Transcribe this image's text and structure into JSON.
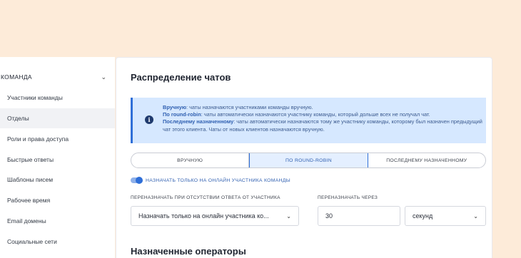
{
  "sidebar": {
    "section_label": "КОМАНДА",
    "items": [
      {
        "label": "Участники команды"
      },
      {
        "label": "Отделы"
      },
      {
        "label": "Роли и права доступа"
      },
      {
        "label": "Быстрые ответы"
      },
      {
        "label": "Шаблоны писем"
      },
      {
        "label": "Рабочее время"
      },
      {
        "label": "Email домены"
      },
      {
        "label": "Социальные сети"
      }
    ],
    "active_item": "Отделы"
  },
  "main": {
    "title": "Распределение чатов",
    "info": {
      "manual_title": "Вручную",
      "manual_text": ": чаты назначаются участниками команды вручную.",
      "rr_title": "По round-robin",
      "rr_text": ": чаты автоматически назначаются участнику команды, который дольше всех не получал чат.",
      "last_title": "Последнему назначенному",
      "last_text": ": чаты автоматически назначаются тому же участнику команды, которому был назначен предыдущий чат этого клиента. Чаты от новых клиентов назначаются вручную."
    },
    "modes": [
      "ВРУЧНУЮ",
      "ПО ROUND-ROBIN",
      "ПОСЛЕДНЕМУ НАЗНАЧЕННОМУ"
    ],
    "selected_mode": "ПО ROUND-ROBIN",
    "toggle_label": "НАЗНАЧАТЬ ТОЛЬКО НА ОНЛАЙН УЧАСТНИКА КОМАНДЫ",
    "toggle_on": true,
    "reassign_label": "ПЕРЕНАЗНАЧАТЬ ПРИ ОТСУТСТВИИ ОТВЕТА ОТ УЧАСТНИКА",
    "reassign_value": "Назначать только на онлайн участника ко...",
    "reassign_after_label": "ПЕРЕНАЗНАЧАТЬ ЧЕРЕЗ",
    "reassign_after_value": "30",
    "unit_value": "секунд",
    "operators_title": "Назначенные операторы"
  },
  "colors": {
    "background": "#fdebd9",
    "accent": "#2f6fd8",
    "info_bg": "#d6e8ff"
  }
}
